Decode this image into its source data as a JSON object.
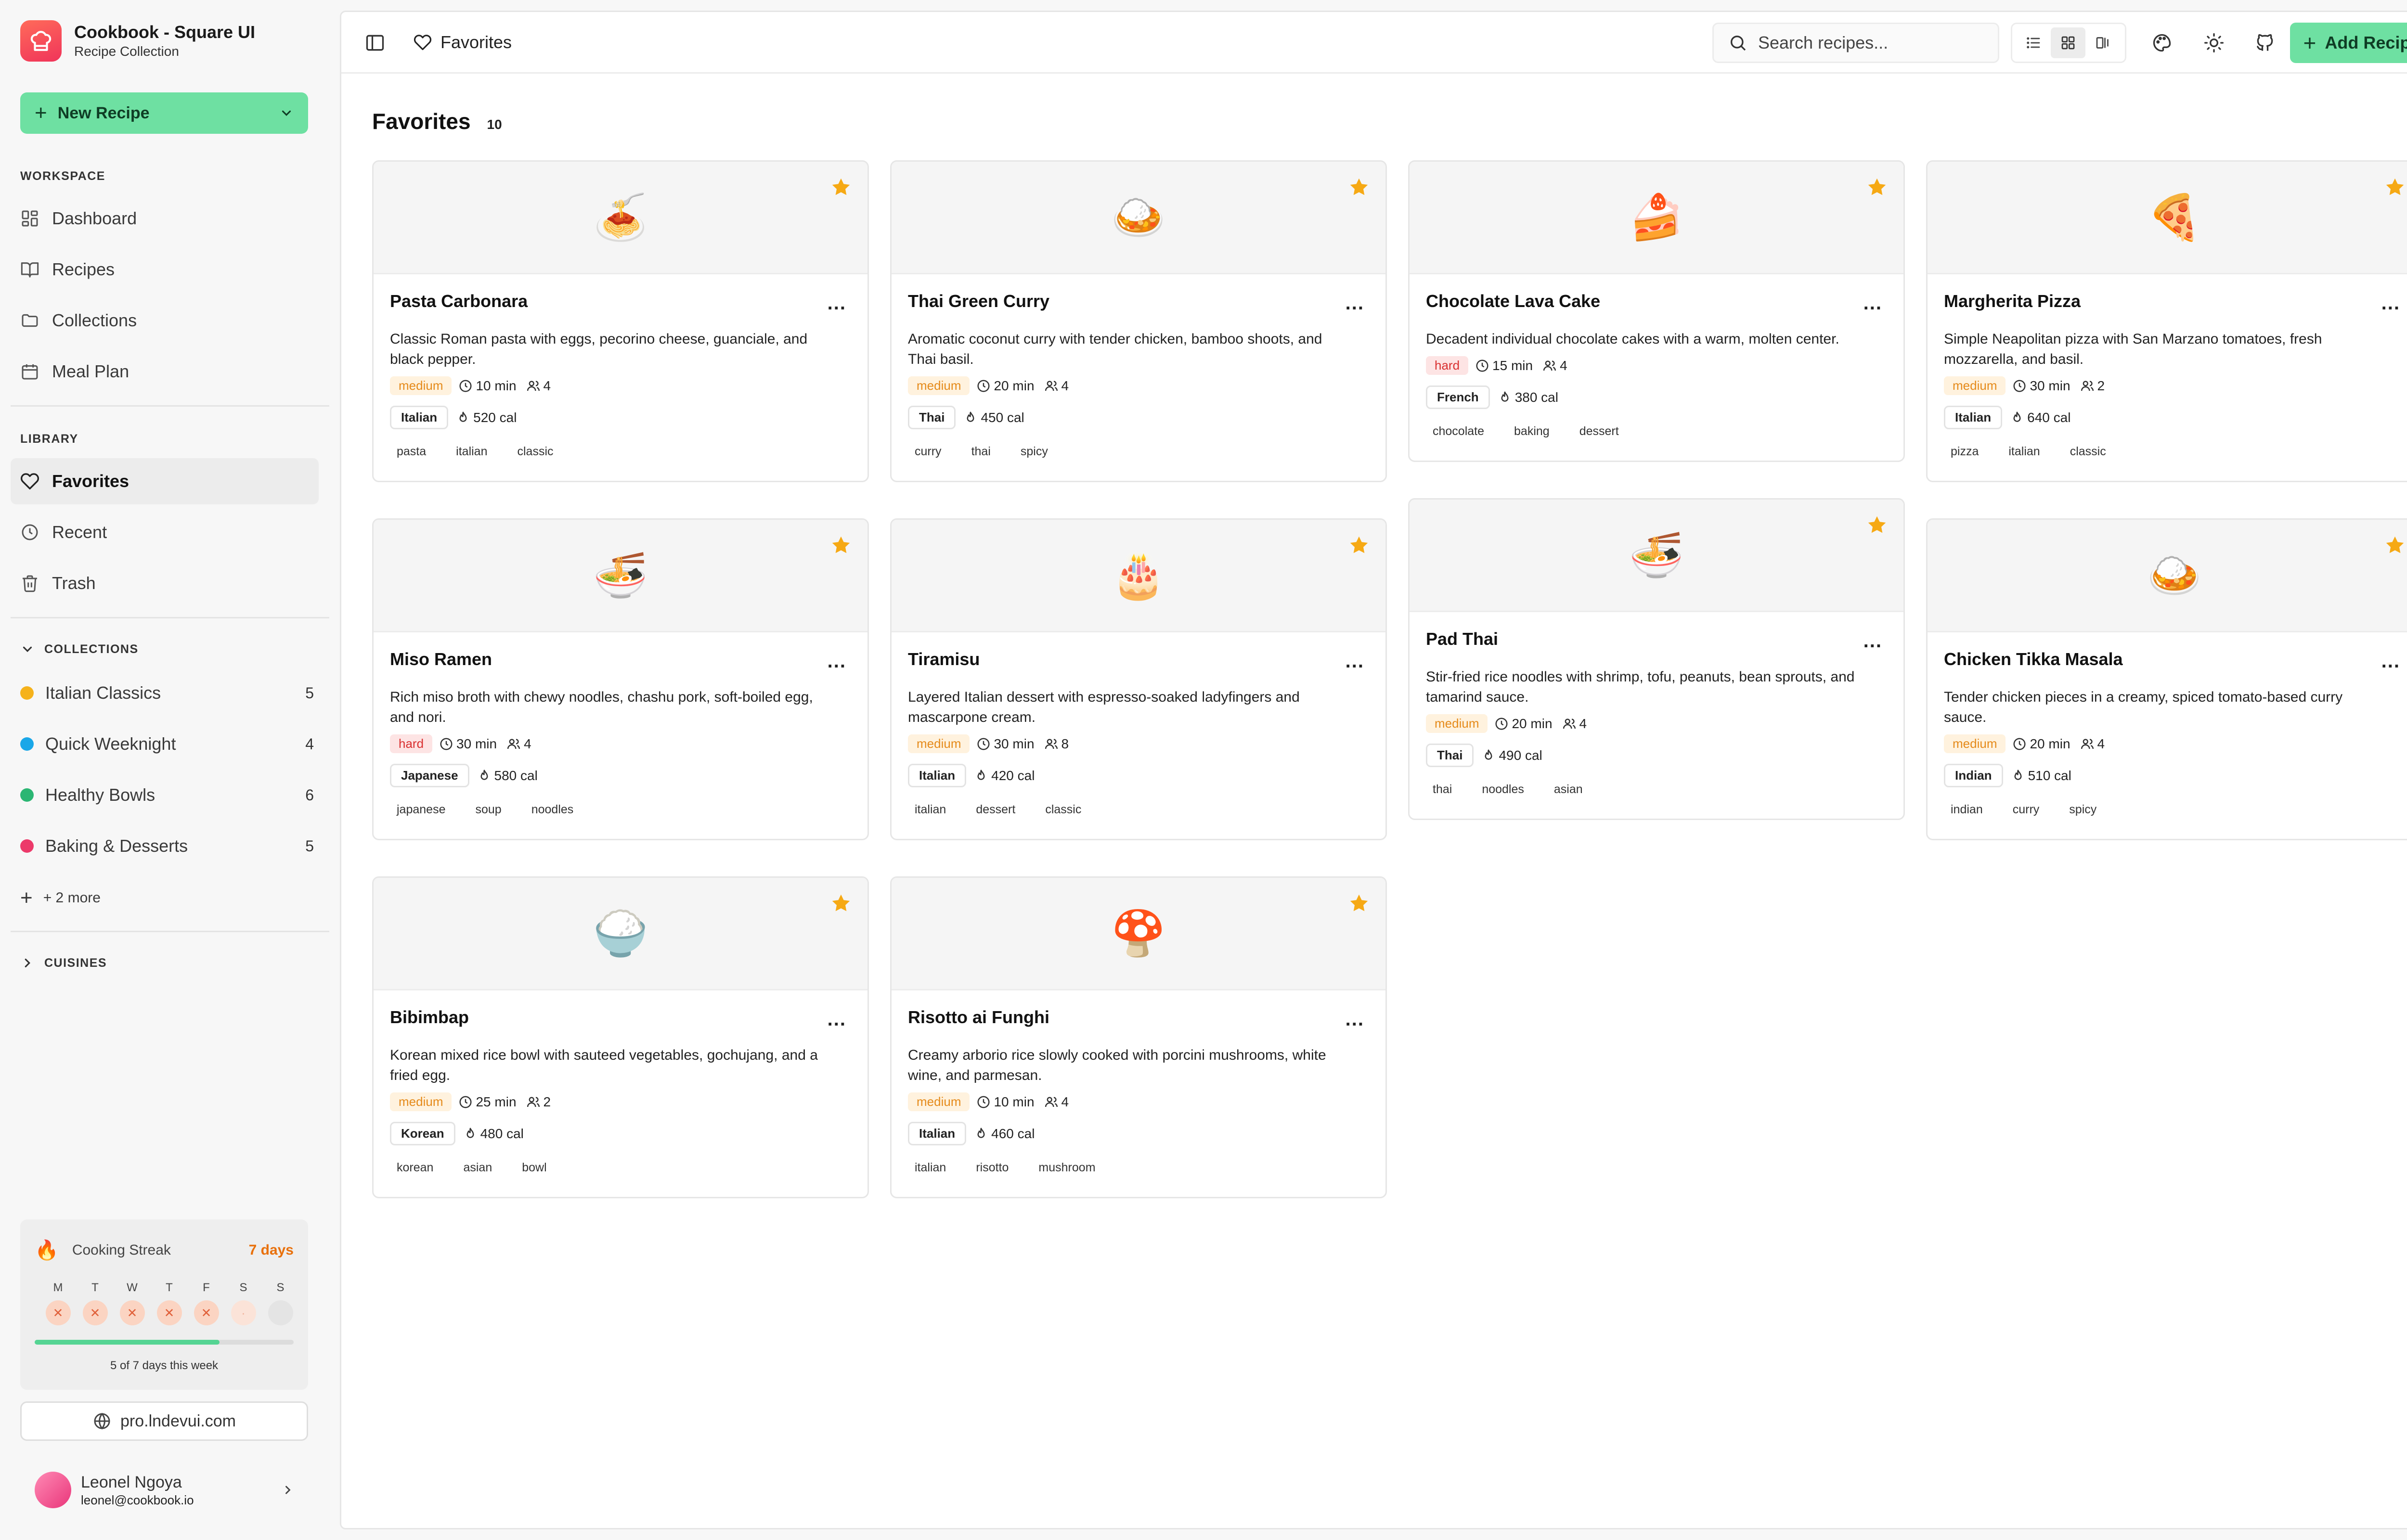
{
  "app": {
    "name": "Cookbook - Square UI",
    "subtitle": "Recipe Collection"
  },
  "sidebar": {
    "new_recipe_label": "New Recipe",
    "workspace_label": "WORKSPACE",
    "workspace_items": [
      {
        "label": "Dashboard",
        "icon": "dashboard-icon"
      },
      {
        "label": "Recipes",
        "icon": "book-icon"
      },
      {
        "label": "Collections",
        "icon": "folder-icon"
      },
      {
        "label": "Meal Plan",
        "icon": "calendar-icon"
      }
    ],
    "library_label": "LIBRARY",
    "library_items": [
      {
        "label": "Favorites",
        "icon": "heart-icon",
        "active": true
      },
      {
        "label": "Recent",
        "icon": "clock-icon"
      },
      {
        "label": "Trash",
        "icon": "trash-icon"
      }
    ],
    "collections_label": "COLLECTIONS",
    "collections": [
      {
        "name": "Italian Classics",
        "count": "5",
        "color": "#f5b21b"
      },
      {
        "name": "Quick Weeknight",
        "count": "4",
        "color": "#1aa7e8"
      },
      {
        "name": "Healthy Bowls",
        "count": "6",
        "color": "#2bb673"
      },
      {
        "name": "Baking & Desserts",
        "count": "5",
        "color": "#ec3a6a"
      }
    ],
    "more_label": "+ 2 more",
    "cuisines_label": "CUISINES",
    "streak": {
      "title": "Cooking Streak",
      "days": "7 days",
      "weekdays": [
        "M",
        "T",
        "W",
        "T",
        "F",
        "S",
        "S"
      ],
      "completed": 5,
      "total": 7,
      "note": "5 of 7 days this week"
    },
    "site_link": "pro.lndevui.com",
    "user": {
      "name": "Leonel Ngoya",
      "email": "leonel@cookbook.io"
    }
  },
  "topbar": {
    "crumb": "Favorites",
    "search_placeholder": "Search recipes...",
    "add_recipe_label": "Add Recipe"
  },
  "page": {
    "title": "Favorites",
    "count": "10"
  },
  "recipes": [
    {
      "title": "Pasta Carbonara",
      "emoji": "🍝",
      "desc": "Classic Roman pasta with eggs, pecorino cheese, guanciale, and black pepper.",
      "difficulty": "medium",
      "time": "10 min",
      "servings": "4",
      "cuisine": "Italian",
      "calories": "520 cal",
      "tags": [
        "pasta",
        "italian",
        "classic"
      ]
    },
    {
      "title": "Thai Green Curry",
      "emoji": "🍛",
      "desc": "Aromatic coconut curry with tender chicken, bamboo shoots, and Thai basil.",
      "difficulty": "medium",
      "time": "20 min",
      "servings": "4",
      "cuisine": "Thai",
      "calories": "450 cal",
      "tags": [
        "curry",
        "thai",
        "spicy"
      ]
    },
    {
      "title": "Chocolate Lava Cake",
      "emoji": "🍰",
      "desc": "Decadent individual chocolate cakes with a warm, molten center.",
      "difficulty": "hard",
      "time": "15 min",
      "servings": "4",
      "cuisine": "French",
      "calories": "380 cal",
      "tags": [
        "chocolate",
        "baking",
        "dessert"
      ]
    },
    {
      "title": "Margherita Pizza",
      "emoji": "🍕",
      "desc": "Simple Neapolitan pizza with San Marzano tomatoes, fresh mozzarella, and basil.",
      "difficulty": "medium",
      "time": "30 min",
      "servings": "2",
      "cuisine": "Italian",
      "calories": "640 cal",
      "tags": [
        "pizza",
        "italian",
        "classic"
      ]
    },
    {
      "title": "Miso Ramen",
      "emoji": "🍜",
      "desc": "Rich miso broth with chewy noodles, chashu pork, soft-boiled egg, and nori.",
      "difficulty": "hard",
      "time": "30 min",
      "servings": "4",
      "cuisine": "Japanese",
      "calories": "580 cal",
      "tags": [
        "japanese",
        "soup",
        "noodles"
      ]
    },
    {
      "title": "Tiramisu",
      "emoji": "🎂",
      "desc": "Layered Italian dessert with espresso-soaked ladyfingers and mascarpone cream.",
      "difficulty": "medium",
      "time": "30 min",
      "servings": "8",
      "cuisine": "Italian",
      "calories": "420 cal",
      "tags": [
        "italian",
        "dessert",
        "classic"
      ]
    },
    {
      "title": "Pad Thai",
      "emoji": "🍜",
      "desc": "Stir-fried rice noodles with shrimp, tofu, peanuts, bean sprouts, and tamarind sauce.",
      "difficulty": "medium",
      "time": "20 min",
      "servings": "4",
      "cuisine": "Thai",
      "calories": "490 cal",
      "tags": [
        "thai",
        "noodles",
        "asian"
      ]
    },
    {
      "title": "Chicken Tikka Masala",
      "emoji": "🍛",
      "desc": "Tender chicken pieces in a creamy, spiced tomato-based curry sauce.",
      "difficulty": "medium",
      "time": "20 min",
      "servings": "4",
      "cuisine": "Indian",
      "calories": "510 cal",
      "tags": [
        "indian",
        "curry",
        "spicy"
      ]
    },
    {
      "title": "Bibimbap",
      "emoji": "🍚",
      "desc": "Korean mixed rice bowl with sauteed vegetables, gochujang, and a fried egg.",
      "difficulty": "medium",
      "time": "25 min",
      "servings": "2",
      "cuisine": "Korean",
      "calories": "480 cal",
      "tags": [
        "korean",
        "asian",
        "bowl"
      ]
    },
    {
      "title": "Risotto ai Funghi",
      "emoji": "🍄",
      "desc": "Creamy arborio rice slowly cooked with porcini mushrooms, white wine, and parmesan.",
      "difficulty": "medium",
      "time": "10 min",
      "servings": "4",
      "cuisine": "Italian",
      "calories": "460 cal",
      "tags": [
        "italian",
        "risotto",
        "mushroom"
      ]
    }
  ],
  "colors": {
    "accent": "#6ee0a2",
    "star": "#f6a914",
    "streak": "#e8700b"
  }
}
